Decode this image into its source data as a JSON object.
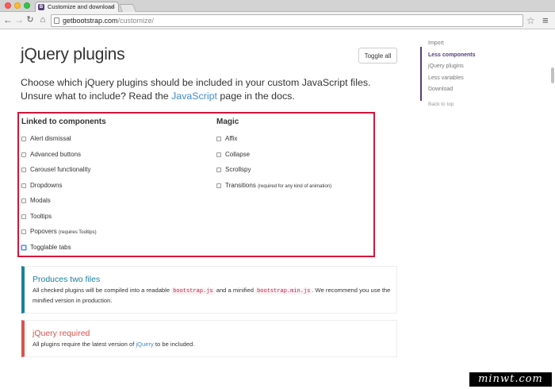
{
  "browser": {
    "tab_title": "Customize and download",
    "tab_favicon_letter": "B",
    "url_host": "getbootstrap.com",
    "url_path": "/customize/"
  },
  "page": {
    "title": "jQuery plugins",
    "toggle_label": "Toggle all",
    "lead_before": "Choose which jQuery plugins should be included in your custom JavaScript files. Unsure what to include? Read the ",
    "lead_link": "JavaScript",
    "lead_after": " page in the docs."
  },
  "groups": {
    "left_title": "Linked to components",
    "right_title": "Magic",
    "left_items": [
      {
        "label": "Alert dismissal",
        "note": ""
      },
      {
        "label": "Advanced buttons",
        "note": ""
      },
      {
        "label": "Carousel functionality",
        "note": ""
      },
      {
        "label": "Dropdowns",
        "note": ""
      },
      {
        "label": "Modals",
        "note": ""
      },
      {
        "label": "Tooltips",
        "note": ""
      },
      {
        "label": "Popovers",
        "note": "(requires Tooltips)"
      },
      {
        "label": "Togglable tabs",
        "note": ""
      }
    ],
    "right_items": [
      {
        "label": "Affix",
        "note": ""
      },
      {
        "label": "Collapse",
        "note": ""
      },
      {
        "label": "Scrollspy",
        "note": ""
      },
      {
        "label": "Transitions",
        "note": "(required for any kind of animation)"
      }
    ]
  },
  "callouts": {
    "info_title": "Produces two files",
    "info_text1": "All checked plugins will be compiled into a readable ",
    "info_code1": "bootstrap.js",
    "info_text2": " and a minified ",
    "info_code2": "bootstrap.min.js",
    "info_text3": ". We recommend you use the minified version in production.",
    "danger_title": "jQuery required",
    "danger_text1": "All plugins require the latest version of ",
    "danger_link": "jQuery",
    "danger_text2": " to be included."
  },
  "sidenav": {
    "items": [
      "Import",
      "Less components",
      "jQuery plugins",
      "Less variables",
      "Download"
    ],
    "back_to_top": "Back to top"
  },
  "watermark": "minwt.com",
  "colors": {
    "highlight_border": "#d4143b",
    "link": "#428bca",
    "info_accent": "#1b809e",
    "danger_accent": "#d9534f",
    "bootstrap_purple": "#563d7c"
  }
}
